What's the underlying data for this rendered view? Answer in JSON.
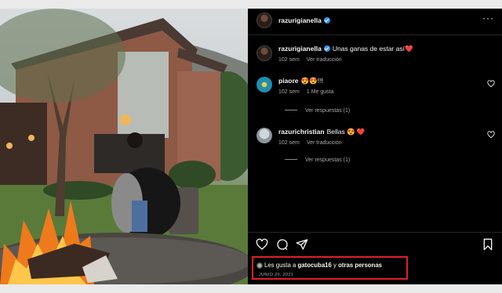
{
  "header": {
    "username": "razurigianella",
    "verified": true
  },
  "caption": {
    "username": "razurigianella",
    "text": "Unas ganas de estar así",
    "emoji": "❤️",
    "age": "102 sem",
    "translate": "Ver traducción"
  },
  "comments": [
    {
      "username": "piaore",
      "text": "😍😍!!!",
      "age": "102 sem",
      "likes": "1 Me gusta",
      "view_replies": "Ver respuestas (1)"
    },
    {
      "username": "razurichristian",
      "text": "Bellas 😍",
      "emoji": "❤️",
      "age": "102 sem",
      "translate": "Ver traducción",
      "view_replies": "Ver respuestas (1)"
    }
  ],
  "likes": {
    "prefix": "Les gusta a",
    "user": "gatocuba16",
    "conjunction": "y",
    "others": "otras personas"
  },
  "date": "JUNIO 20, 2021",
  "icons": [
    "more-options-icon",
    "like-heart-icon",
    "comment-icon",
    "share-icon",
    "save-bookmark-icon"
  ],
  "colors": {
    "background": "#000000",
    "secondary_text": "#a8a8a8",
    "verified": "#3897f0",
    "highlight_border": "#e01e2b",
    "heart": "#ed4956"
  }
}
